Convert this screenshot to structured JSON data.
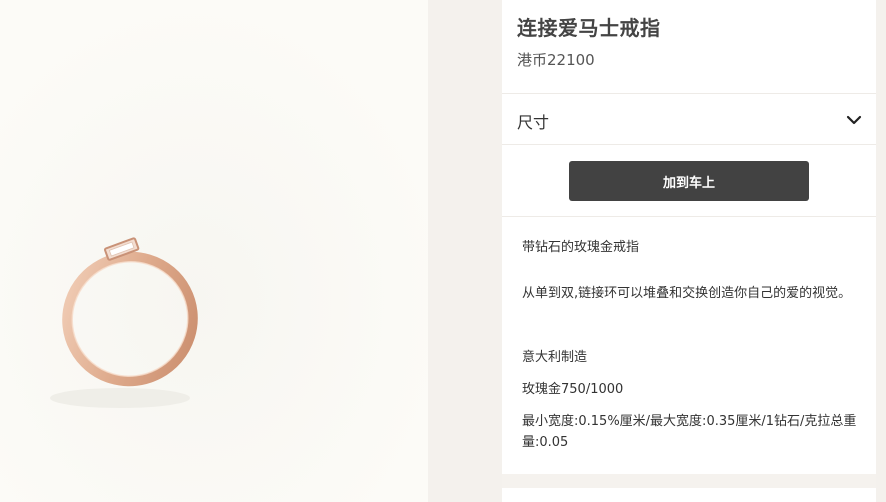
{
  "product": {
    "title": "连接爱马士戒指",
    "price": "港币22100",
    "image_alt": "rose-gold ring with baguette diamond"
  },
  "size_selector": {
    "label": "尺寸",
    "icon": "chevron-down-icon"
  },
  "actions": {
    "add_to_cart_label": "加到车上"
  },
  "description": {
    "subtitle": "带钻石的玫瑰金戒指",
    "body": "从单到双,链接环可以堆叠和交换创造你自己的爱的视觉。",
    "origin": "意大利制造",
    "material": "玫瑰金750/1000",
    "specs": "最小宽度:0.15%厘米/最大宽度:0.35厘米/1钻石/克拉总重量:0.05"
  },
  "colors": {
    "button": "#424242",
    "ring": "#e4b59b",
    "page_background": "#f5f2ee"
  }
}
